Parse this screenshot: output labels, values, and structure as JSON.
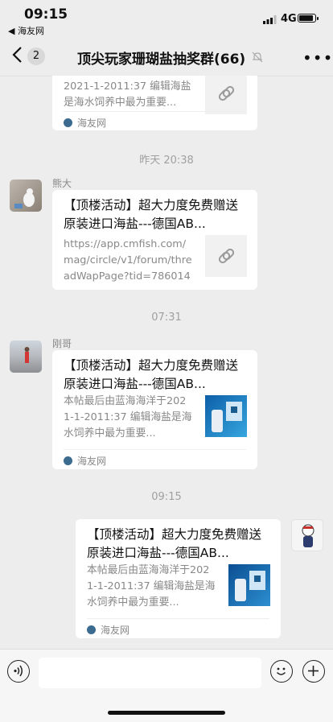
{
  "status_bar": {
    "time": "09:15",
    "back_app": "◀ 海友网",
    "network": "4G"
  },
  "nav": {
    "member_count": "2",
    "title": "顶尖玩家珊瑚盐抽奖群(66)"
  },
  "messages": [
    {
      "type": "card",
      "text_desc": "2021-1-2011:37 编辑海盐是海水饲养中最为重要...",
      "source": "海友网",
      "thumb": "link-icon"
    },
    {
      "type": "timestamp",
      "text": "昨天 20:38"
    },
    {
      "type": "card",
      "sender": "熊大",
      "title": "【顶楼活动】超大力度免费赠送原装进口海盐---德国AB...",
      "desc": "https://app.cmfish.com/mag/circle/v1/forum/threadWapPage?tid=786014&...",
      "thumb": "link-icon"
    },
    {
      "type": "timestamp",
      "text": "07:31"
    },
    {
      "type": "card",
      "sender": "刚哥",
      "title": "【顶楼活动】超大力度免费赠送原装进口海盐---德国AB...",
      "desc": "本帖最后由蓝海海洋于2021-1-2011:37 编辑海盐是海水饲养中最为重要...",
      "source": "海友网",
      "thumb": "product-image"
    },
    {
      "type": "timestamp",
      "text": "09:15"
    },
    {
      "type": "card",
      "self": true,
      "title": "【顶楼活动】超大力度免费赠送原装进口海盐---德国AB...",
      "desc": "本帖最后由蓝海海洋于2021-1-2011:37 编辑海盐是海水饲养中最为重要...",
      "source": "海友网",
      "thumb": "product-image"
    }
  ]
}
